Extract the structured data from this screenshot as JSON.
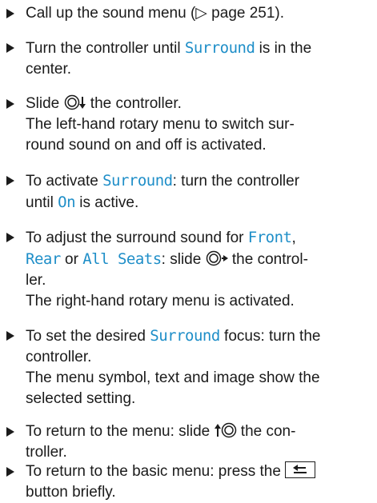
{
  "items": [
    {
      "lines": [
        "Call up the sound menu (▷ page 251)."
      ]
    },
    {
      "prefix": "Turn the controller until ",
      "kw": "Surround",
      "suffix": " is in the",
      "line2": "center."
    },
    {
      "a": "Slide ",
      "b": " the controller.",
      "desc1": "The left-hand rotary menu to switch sur-",
      "desc2": "round sound on and off is activated."
    },
    {
      "a": "To activate ",
      "kw": "Surround",
      "b": ": turn the controller",
      "c": "until ",
      "kw2": "On",
      "d": " is active."
    },
    {
      "a": "To adjust the surround sound for ",
      "kw1": "Front",
      "b": ",",
      "kw2": "Rear",
      "c": " or ",
      "kw3": "All Seats",
      "d": ": slide ",
      "e": " the control-",
      "f": "ler.",
      "desc": "The right-hand rotary menu is activated."
    },
    {
      "a": "To set the desired ",
      "kw": "Surround",
      "b": " focus: turn the",
      "c": "controller.",
      "desc1": "The menu symbol, text and image show the",
      "desc2": "selected setting."
    },
    {
      "a": "To return to the menu: slide ",
      "b": " the con-",
      "c": "troller."
    },
    {
      "a": "To return to the basic menu: press the ",
      "c": "button briefly."
    }
  ],
  "icons": {
    "controller": "controller-knob-icon",
    "back_button": "back-button-icon"
  },
  "colors": {
    "highlight": "#1e8ec8",
    "text": "#1b1b1b"
  }
}
